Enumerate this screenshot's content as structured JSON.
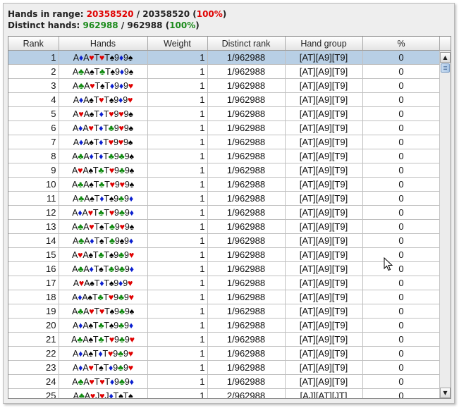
{
  "stats": {
    "range_label": "Hands in range:",
    "range_count": "20358520",
    "range_total": "20358520",
    "range_pct": "100%",
    "distinct_label": "Distinct hands:",
    "distinct_count": "962988",
    "distinct_total": "962988",
    "distinct_pct": "100%"
  },
  "table": {
    "columns": [
      "Rank",
      "Hands",
      "Weight",
      "Distinct rank",
      "Hand group",
      "%"
    ],
    "selected_row": 1,
    "rows": [
      {
        "rank": "1",
        "hand": [
          [
            "A",
            "d"
          ],
          [
            "A",
            "h"
          ],
          [
            "T",
            "h"
          ],
          [
            "T",
            "s"
          ],
          [
            "9",
            "d"
          ],
          [
            "9",
            "s"
          ]
        ],
        "weight": "1",
        "distinct": "1/962988",
        "group": "[AT][A9][T9]",
        "pct": "0"
      },
      {
        "rank": "2",
        "hand": [
          [
            "A",
            "c"
          ],
          [
            "A",
            "s"
          ],
          [
            "T",
            "c"
          ],
          [
            "T",
            "s"
          ],
          [
            "9",
            "d"
          ],
          [
            "9",
            "s"
          ]
        ],
        "weight": "1",
        "distinct": "1/962988",
        "group": "[AT][A9][T9]",
        "pct": "0"
      },
      {
        "rank": "3",
        "hand": [
          [
            "A",
            "c"
          ],
          [
            "A",
            "h"
          ],
          [
            "T",
            "s"
          ],
          [
            "T",
            "d"
          ],
          [
            "9",
            "d"
          ],
          [
            "9",
            "h"
          ]
        ],
        "weight": "1",
        "distinct": "1/962988",
        "group": "[AT][A9][T9]",
        "pct": "0"
      },
      {
        "rank": "4",
        "hand": [
          [
            "A",
            "d"
          ],
          [
            "A",
            "s"
          ],
          [
            "T",
            "h"
          ],
          [
            "T",
            "s"
          ],
          [
            "9",
            "d"
          ],
          [
            "9",
            "h"
          ]
        ],
        "weight": "1",
        "distinct": "1/962988",
        "group": "[AT][A9][T9]",
        "pct": "0"
      },
      {
        "rank": "5",
        "hand": [
          [
            "A",
            "h"
          ],
          [
            "A",
            "s"
          ],
          [
            "T",
            "d"
          ],
          [
            "T",
            "h"
          ],
          [
            "9",
            "h"
          ],
          [
            "9",
            "s"
          ]
        ],
        "weight": "1",
        "distinct": "1/962988",
        "group": "[AT][A9][T9]",
        "pct": "0"
      },
      {
        "rank": "6",
        "hand": [
          [
            "A",
            "d"
          ],
          [
            "A",
            "h"
          ],
          [
            "T",
            "d"
          ],
          [
            "T",
            "c"
          ],
          [
            "9",
            "h"
          ],
          [
            "9",
            "s"
          ]
        ],
        "weight": "1",
        "distinct": "1/962988",
        "group": "[AT][A9][T9]",
        "pct": "0"
      },
      {
        "rank": "7",
        "hand": [
          [
            "A",
            "d"
          ],
          [
            "A",
            "s"
          ],
          [
            "T",
            "d"
          ],
          [
            "T",
            "h"
          ],
          [
            "9",
            "h"
          ],
          [
            "9",
            "s"
          ]
        ],
        "weight": "1",
        "distinct": "1/962988",
        "group": "[AT][A9][T9]",
        "pct": "0"
      },
      {
        "rank": "8",
        "hand": [
          [
            "A",
            "c"
          ],
          [
            "A",
            "d"
          ],
          [
            "T",
            "d"
          ],
          [
            "T",
            "c"
          ],
          [
            "9",
            "c"
          ],
          [
            "9",
            "s"
          ]
        ],
        "weight": "1",
        "distinct": "1/962988",
        "group": "[AT][A9][T9]",
        "pct": "0"
      },
      {
        "rank": "9",
        "hand": [
          [
            "A",
            "h"
          ],
          [
            "A",
            "s"
          ],
          [
            "T",
            "c"
          ],
          [
            "T",
            "h"
          ],
          [
            "9",
            "c"
          ],
          [
            "9",
            "s"
          ]
        ],
        "weight": "1",
        "distinct": "1/962988",
        "group": "[AT][A9][T9]",
        "pct": "0"
      },
      {
        "rank": "10",
        "hand": [
          [
            "A",
            "c"
          ],
          [
            "A",
            "s"
          ],
          [
            "T",
            "c"
          ],
          [
            "T",
            "h"
          ],
          [
            "9",
            "h"
          ],
          [
            "9",
            "s"
          ]
        ],
        "weight": "1",
        "distinct": "1/962988",
        "group": "[AT][A9][T9]",
        "pct": "0"
      },
      {
        "rank": "11",
        "hand": [
          [
            "A",
            "c"
          ],
          [
            "A",
            "s"
          ],
          [
            "T",
            "d"
          ],
          [
            "T",
            "s"
          ],
          [
            "9",
            "c"
          ],
          [
            "9",
            "d"
          ]
        ],
        "weight": "1",
        "distinct": "1/962988",
        "group": "[AT][A9][T9]",
        "pct": "0"
      },
      {
        "rank": "12",
        "hand": [
          [
            "A",
            "d"
          ],
          [
            "A",
            "h"
          ],
          [
            "T",
            "c"
          ],
          [
            "T",
            "h"
          ],
          [
            "9",
            "c"
          ],
          [
            "9",
            "d"
          ]
        ],
        "weight": "1",
        "distinct": "1/962988",
        "group": "[AT][A9][T9]",
        "pct": "0"
      },
      {
        "rank": "13",
        "hand": [
          [
            "A",
            "c"
          ],
          [
            "A",
            "h"
          ],
          [
            "T",
            "s"
          ],
          [
            "T",
            "c"
          ],
          [
            "9",
            "h"
          ],
          [
            "9",
            "s"
          ]
        ],
        "weight": "1",
        "distinct": "1/962988",
        "group": "[AT][A9][T9]",
        "pct": "0"
      },
      {
        "rank": "14",
        "hand": [
          [
            "A",
            "c"
          ],
          [
            "A",
            "d"
          ],
          [
            "T",
            "s"
          ],
          [
            "T",
            "c"
          ],
          [
            "9",
            "s"
          ],
          [
            "9",
            "d"
          ]
        ],
        "weight": "1",
        "distinct": "1/962988",
        "group": "[AT][A9][T9]",
        "pct": "0"
      },
      {
        "rank": "15",
        "hand": [
          [
            "A",
            "h"
          ],
          [
            "A",
            "s"
          ],
          [
            "T",
            "c"
          ],
          [
            "T",
            "s"
          ],
          [
            "9",
            "c"
          ],
          [
            "9",
            "h"
          ]
        ],
        "weight": "1",
        "distinct": "1/962988",
        "group": "[AT][A9][T9]",
        "pct": "0"
      },
      {
        "rank": "16",
        "hand": [
          [
            "A",
            "c"
          ],
          [
            "A",
            "d"
          ],
          [
            "T",
            "s"
          ],
          [
            "T",
            "c"
          ],
          [
            "9",
            "c"
          ],
          [
            "9",
            "d"
          ]
        ],
        "weight": "1",
        "distinct": "1/962988",
        "group": "[AT][A9][T9]",
        "pct": "0"
      },
      {
        "rank": "17",
        "hand": [
          [
            "A",
            "h"
          ],
          [
            "A",
            "s"
          ],
          [
            "T",
            "d"
          ],
          [
            "T",
            "s"
          ],
          [
            "9",
            "d"
          ],
          [
            "9",
            "h"
          ]
        ],
        "weight": "1",
        "distinct": "1/962988",
        "group": "[AT][A9][T9]",
        "pct": "0"
      },
      {
        "rank": "18",
        "hand": [
          [
            "A",
            "d"
          ],
          [
            "A",
            "s"
          ],
          [
            "T",
            "c"
          ],
          [
            "T",
            "h"
          ],
          [
            "9",
            "c"
          ],
          [
            "9",
            "h"
          ]
        ],
        "weight": "1",
        "distinct": "1/962988",
        "group": "[AT][A9][T9]",
        "pct": "0"
      },
      {
        "rank": "19",
        "hand": [
          [
            "A",
            "c"
          ],
          [
            "A",
            "h"
          ],
          [
            "T",
            "h"
          ],
          [
            "T",
            "s"
          ],
          [
            "9",
            "c"
          ],
          [
            "9",
            "s"
          ]
        ],
        "weight": "1",
        "distinct": "1/962988",
        "group": "[AT][A9][T9]",
        "pct": "0"
      },
      {
        "rank": "20",
        "hand": [
          [
            "A",
            "d"
          ],
          [
            "A",
            "s"
          ],
          [
            "T",
            "c"
          ],
          [
            "T",
            "s"
          ],
          [
            "9",
            "c"
          ],
          [
            "9",
            "d"
          ]
        ],
        "weight": "1",
        "distinct": "1/962988",
        "group": "[AT][A9][T9]",
        "pct": "0"
      },
      {
        "rank": "21",
        "hand": [
          [
            "A",
            "c"
          ],
          [
            "A",
            "s"
          ],
          [
            "T",
            "c"
          ],
          [
            "T",
            "h"
          ],
          [
            "9",
            "c"
          ],
          [
            "9",
            "h"
          ]
        ],
        "weight": "1",
        "distinct": "1/962988",
        "group": "[AT][A9][T9]",
        "pct": "0"
      },
      {
        "rank": "22",
        "hand": [
          [
            "A",
            "d"
          ],
          [
            "A",
            "s"
          ],
          [
            "T",
            "d"
          ],
          [
            "T",
            "h"
          ],
          [
            "9",
            "c"
          ],
          [
            "9",
            "h"
          ]
        ],
        "weight": "1",
        "distinct": "1/962988",
        "group": "[AT][A9][T9]",
        "pct": "0"
      },
      {
        "rank": "23",
        "hand": [
          [
            "A",
            "d"
          ],
          [
            "A",
            "h"
          ],
          [
            "T",
            "s"
          ],
          [
            "T",
            "d"
          ],
          [
            "9",
            "c"
          ],
          [
            "9",
            "h"
          ]
        ],
        "weight": "1",
        "distinct": "1/962988",
        "group": "[AT][A9][T9]",
        "pct": "0"
      },
      {
        "rank": "24",
        "hand": [
          [
            "A",
            "c"
          ],
          [
            "A",
            "h"
          ],
          [
            "T",
            "h"
          ],
          [
            "T",
            "d"
          ],
          [
            "9",
            "c"
          ],
          [
            "9",
            "d"
          ]
        ],
        "weight": "1",
        "distinct": "1/962988",
        "group": "[AT][A9][T9]",
        "pct": "0"
      },
      {
        "rank": "25",
        "hand": [
          [
            "A",
            "c"
          ],
          [
            "A",
            "h"
          ],
          [
            "J",
            "h"
          ],
          [
            "J",
            "d"
          ],
          [
            "T",
            "s"
          ],
          [
            "T",
            "s"
          ]
        ],
        "weight": "1",
        "distinct": "2/962988",
        "group": "[AJ][AT][JT]",
        "pct": "0"
      }
    ]
  },
  "suits": {
    "s": {
      "glyph": "♠",
      "color": "#000000"
    },
    "h": {
      "glyph": "♥",
      "color": "#e00000"
    },
    "d": {
      "glyph": "♦",
      "color": "#0a1fd0"
    },
    "c": {
      "glyph": "♣",
      "color": "#0f8a0f"
    }
  },
  "icons": {
    "scroll_up": "▲",
    "scroll_down": "▼"
  }
}
